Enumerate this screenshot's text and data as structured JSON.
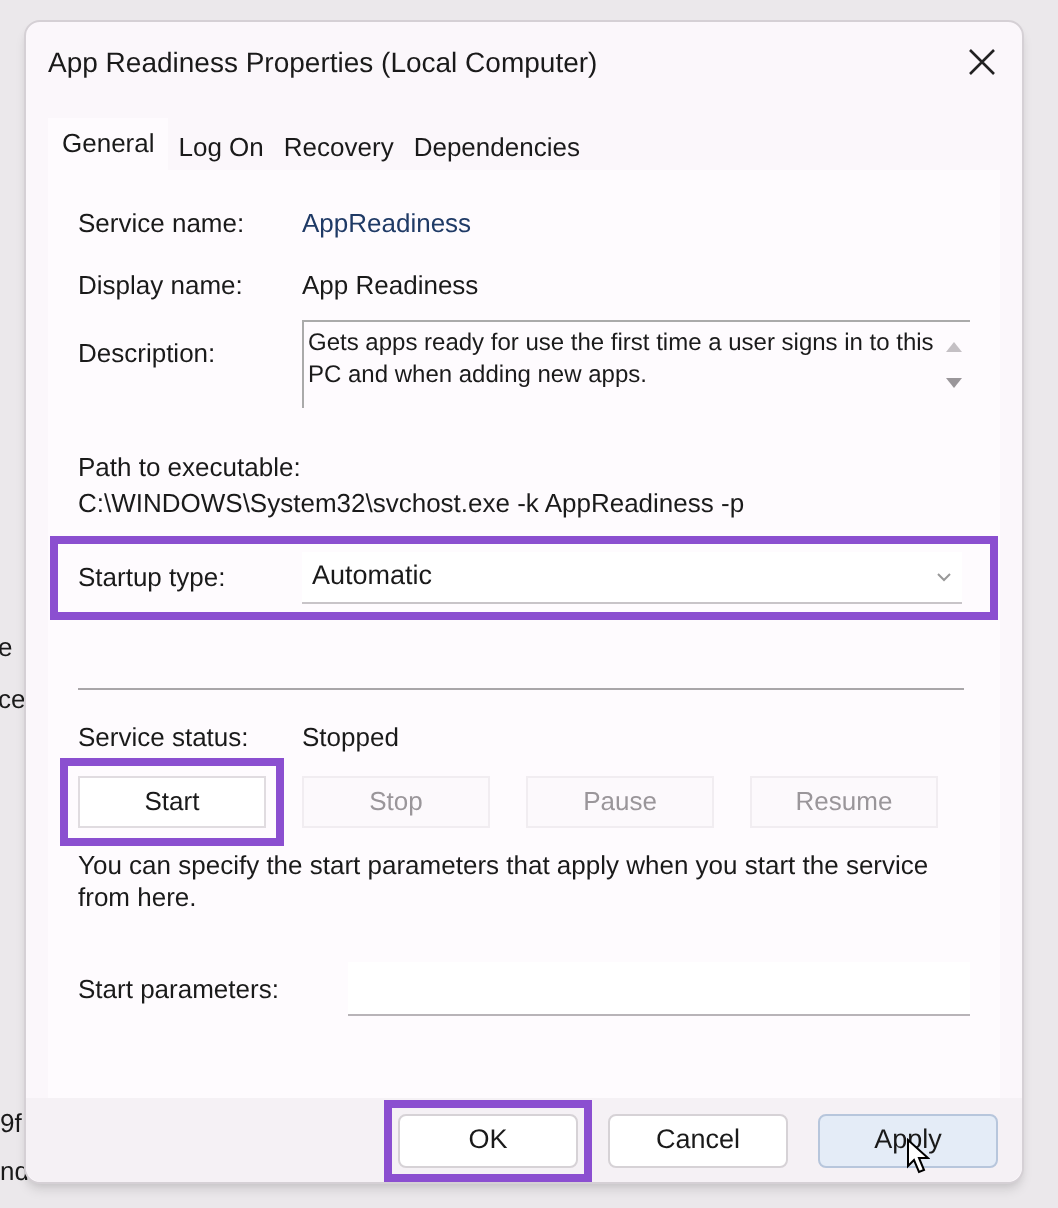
{
  "background_fragments": [
    "e",
    "ce",
    "9f",
    "nd"
  ],
  "window": {
    "title": "App Readiness Properties (Local Computer)"
  },
  "tabs": [
    {
      "label": "General",
      "selected": true
    },
    {
      "label": "Log On",
      "selected": false
    },
    {
      "label": "Recovery",
      "selected": false
    },
    {
      "label": "Dependencies",
      "selected": false
    }
  ],
  "service_name": {
    "label": "Service name:",
    "value": "AppReadiness"
  },
  "display_name": {
    "label": "Display name:",
    "value": "App Readiness"
  },
  "description": {
    "label": "Description:",
    "value": "Gets apps ready for use the first time a user signs in to this PC and when adding new apps."
  },
  "path": {
    "label": "Path to executable:",
    "value": "C:\\WINDOWS\\System32\\svchost.exe -k AppReadiness -p"
  },
  "startup_type": {
    "label": "Startup type:",
    "value": "Automatic",
    "highlighted": true
  },
  "service_status": {
    "label": "Service status:",
    "value": "Stopped"
  },
  "service_buttons": [
    {
      "label": "Start",
      "disabled": false,
      "highlighted": true
    },
    {
      "label": "Stop",
      "disabled": true,
      "highlighted": false
    },
    {
      "label": "Pause",
      "disabled": true,
      "highlighted": false
    },
    {
      "label": "Resume",
      "disabled": true,
      "highlighted": false
    }
  ],
  "hint": "You can specify the start parameters that apply when you start the service from here.",
  "start_parameters": {
    "label": "Start parameters:"
  },
  "dialog_buttons": [
    {
      "label": "OK",
      "highlighted": true,
      "hovered": false
    },
    {
      "label": "Cancel",
      "highlighted": false,
      "hovered": false
    },
    {
      "label": "Apply",
      "highlighted": false,
      "hovered": true
    }
  ]
}
